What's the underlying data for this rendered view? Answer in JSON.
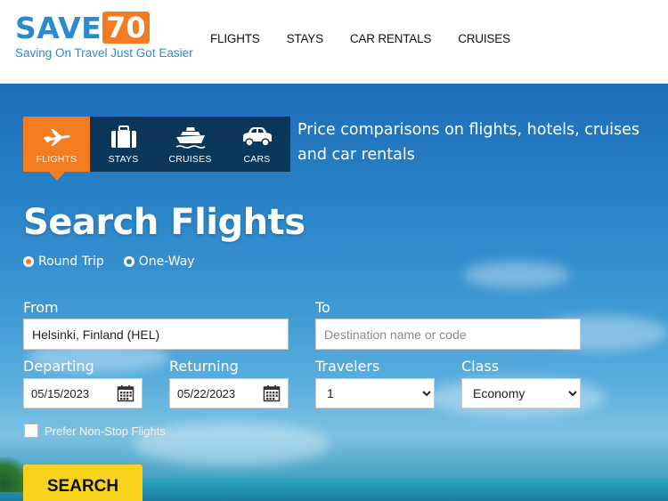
{
  "brand": {
    "word": "SAVE",
    "number": "70",
    "tagline": "Saving On Travel Just Got Easier"
  },
  "nav": [
    {
      "label": "FLIGHTS"
    },
    {
      "label": "STAYS"
    },
    {
      "label": "CAR RENTALS"
    },
    {
      "label": "CRUISES"
    }
  ],
  "tabs": [
    {
      "label": "FLIGHTS",
      "icon": "airplane-icon",
      "active": true
    },
    {
      "label": "STAYS",
      "icon": "suitcase-icon",
      "active": false
    },
    {
      "label": "CRUISES",
      "icon": "ship-icon",
      "active": false
    },
    {
      "label": "CARS",
      "icon": "car-icon",
      "active": false
    }
  ],
  "hero_text": "Price comparisons on flights, hotels, cruises and car rentals",
  "form": {
    "title": "Search Flights",
    "trip_types": [
      {
        "label": "Round Trip",
        "checked": true
      },
      {
        "label": "One-Way",
        "checked": false
      }
    ],
    "from_label": "From",
    "from_value": "Helsinki, Finland (HEL)",
    "to_label": "To",
    "to_placeholder": "Destination name or code",
    "departing_label": "Departing",
    "departing_value": "05/15/2023",
    "returning_label": "Returning",
    "returning_value": "05/22/2023",
    "travelers_label": "Travelers",
    "travelers_value": "1",
    "class_label": "Class",
    "class_value": "Economy",
    "nonstop_label": "Prefer Non-Stop Flights",
    "search_label": "SEARCH"
  },
  "colors": {
    "accent": "#f47c20",
    "brand_blue": "#2b8bcf",
    "button": "#f7d31e"
  }
}
